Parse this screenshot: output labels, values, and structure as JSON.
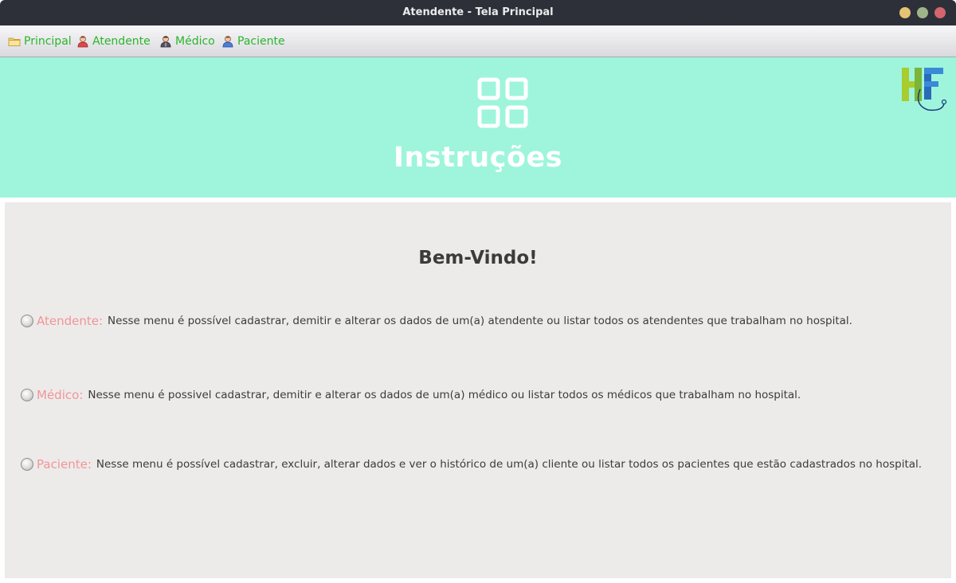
{
  "window": {
    "title": "Atendente - Tela Principal"
  },
  "menu": {
    "items": [
      {
        "label": "Principal",
        "icon": "folder-icon"
      },
      {
        "label": "Atendente",
        "icon": "user-red-icon"
      },
      {
        "label": "Médico",
        "icon": "user-dark-icon"
      },
      {
        "label": "Paciente",
        "icon": "user-blue-icon"
      }
    ]
  },
  "header": {
    "title": "Instruções",
    "icon": "grid-icon",
    "logo": "hf-logo-icon"
  },
  "content": {
    "welcome": "Bem-Vindo!",
    "items": [
      {
        "label": "Atendente:",
        "text": "Nesse menu é possível cadastrar, demitir e alterar os dados de um(a) atendente ou listar todos os atendentes que trabalham no hospital."
      },
      {
        "label": "Médico:",
        "text": "Nesse menu é possivel cadastrar, demitir e alterar os dados de um(a) médico ou listar todos os médicos que trabalham no hospital."
      },
      {
        "label": "Paciente:",
        "text": "Nesse menu é possível cadastrar, excluir, alterar dados e ver o histórico de um(a) cliente ou listar todos os pacientes que estão cadastrados no hospital."
      }
    ]
  },
  "colors": {
    "titlebar": "#2d3039",
    "menu_text": "#2bb52b",
    "header_bg": "#9ef5dc",
    "content_bg": "#edebe9",
    "label": "#f0959a"
  }
}
